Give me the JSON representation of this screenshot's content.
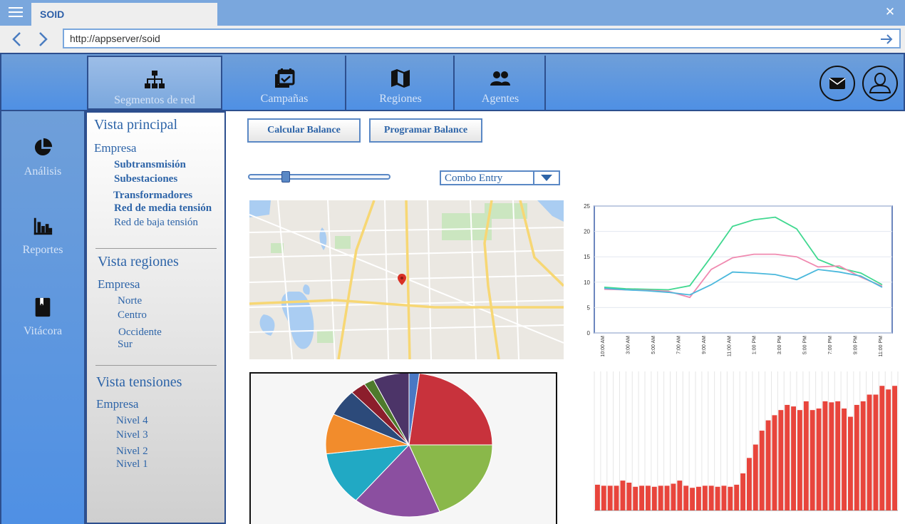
{
  "window": {
    "title": "SOID",
    "url": "http://appserver/soid"
  },
  "top_tabs": [
    {
      "label": "Segmentos de red",
      "icon": "sitemap-icon"
    },
    {
      "label": "Campañas",
      "icon": "calendar-check-icon"
    },
    {
      "label": "Regiones",
      "icon": "map-icon"
    },
    {
      "label": "Agentes",
      "icon": "group-icon"
    }
  ],
  "header_actions": {
    "mail_icon": "mail-icon",
    "user_icon": "user-icon"
  },
  "side_rail": [
    {
      "label": "Análisis",
      "icon": "pie-chart-icon"
    },
    {
      "label": "Reportes",
      "icon": "bar-chart-icon"
    },
    {
      "label": "Vitácora",
      "icon": "book-icon"
    }
  ],
  "tree": {
    "principal": {
      "title": "Vista principal",
      "root": "Empresa",
      "items": [
        "Subtransmisión",
        "Subestaciones",
        "Transformadores",
        "Red de media tensión",
        "Red de baja tensión"
      ]
    },
    "regiones": {
      "title": "Vista regiones",
      "root": "Empresa",
      "items": [
        "Norte",
        "Centro",
        "Occidente",
        "Sur"
      ]
    },
    "tensiones": {
      "title": "Vista tensiones",
      "root": "Empresa",
      "items": [
        "Nivel 4",
        "Nivel 3",
        "Nivel 2",
        "Nivel 1"
      ]
    }
  },
  "actions": {
    "calc_label": "Calcular Balance",
    "prog_label": "Programar Balance"
  },
  "slider": {
    "value": 0.25
  },
  "combo": {
    "value": "Combo Entry"
  },
  "colors": {
    "accent": "#4f90e4",
    "dark_border": "#2d4f8e",
    "link": "#2d64a8"
  },
  "chart_data": [
    {
      "type": "pie",
      "values": [
        2,
        23,
        19,
        17,
        12,
        9,
        6,
        3,
        2,
        7
      ],
      "colors": [
        "#4a78c4",
        "#c8323c",
        "#8ab84a",
        "#8b4fa0",
        "#21a9c4",
        "#f28c2c",
        "#2c4a7a",
        "#8c1e2c",
        "#4e7a2c",
        "#4c3468"
      ]
    },
    {
      "type": "line",
      "ylim": [
        0,
        25
      ],
      "yticks": [
        0,
        5,
        10,
        15,
        20,
        25
      ],
      "categories": [
        "10:00 AM",
        "3:00 AM",
        "5:00 AM",
        "7:00 AM",
        "9:00 AM",
        "11:00 AM",
        "1:00 PM",
        "3:00 PM",
        "5:00 PM",
        "7:00 PM",
        "9:00 PM",
        "11:00 PM"
      ],
      "series": [
        {
          "color": "#40d890",
          "values": [
            9.0,
            8.7,
            8.6,
            8.5,
            9.3,
            15.0,
            21.0,
            22.3,
            22.8,
            20.5,
            14.5,
            12.8,
            11.8,
            9.5
          ]
        },
        {
          "color": "#f08ab0",
          "values": [
            8.6,
            8.5,
            8.4,
            8.2,
            7.0,
            12.5,
            14.8,
            15.5,
            15.5,
            15.0,
            13.0,
            13.2,
            11.0,
            9.2
          ]
        },
        {
          "color": "#4ab8dc",
          "values": [
            8.8,
            8.5,
            8.3,
            8.0,
            7.5,
            9.5,
            12.0,
            11.8,
            11.5,
            10.5,
            12.5,
            12.0,
            11.2,
            9.0
          ]
        }
      ]
    },
    {
      "type": "bar",
      "ylim": [
        0,
        27
      ],
      "color": "#e8453c",
      "values": [
        5,
        4.8,
        4.8,
        4.8,
        5.8,
        5.4,
        4.6,
        4.8,
        4.8,
        4.6,
        4.8,
        4.8,
        5.2,
        5.8,
        4.8,
        4.4,
        4.6,
        4.8,
        4.8,
        4.6,
        4.8,
        4.6,
        5,
        7.2,
        10.2,
        12.8,
        15.5,
        17.5,
        18.5,
        19.5,
        20.5,
        20.2,
        19.5,
        21.2,
        19.5,
        19.8,
        21.2,
        21,
        21.2,
        19.8,
        18.2,
        20.5,
        21.2,
        22.5,
        22.5,
        24.2,
        23.5,
        24.2
      ]
    }
  ]
}
